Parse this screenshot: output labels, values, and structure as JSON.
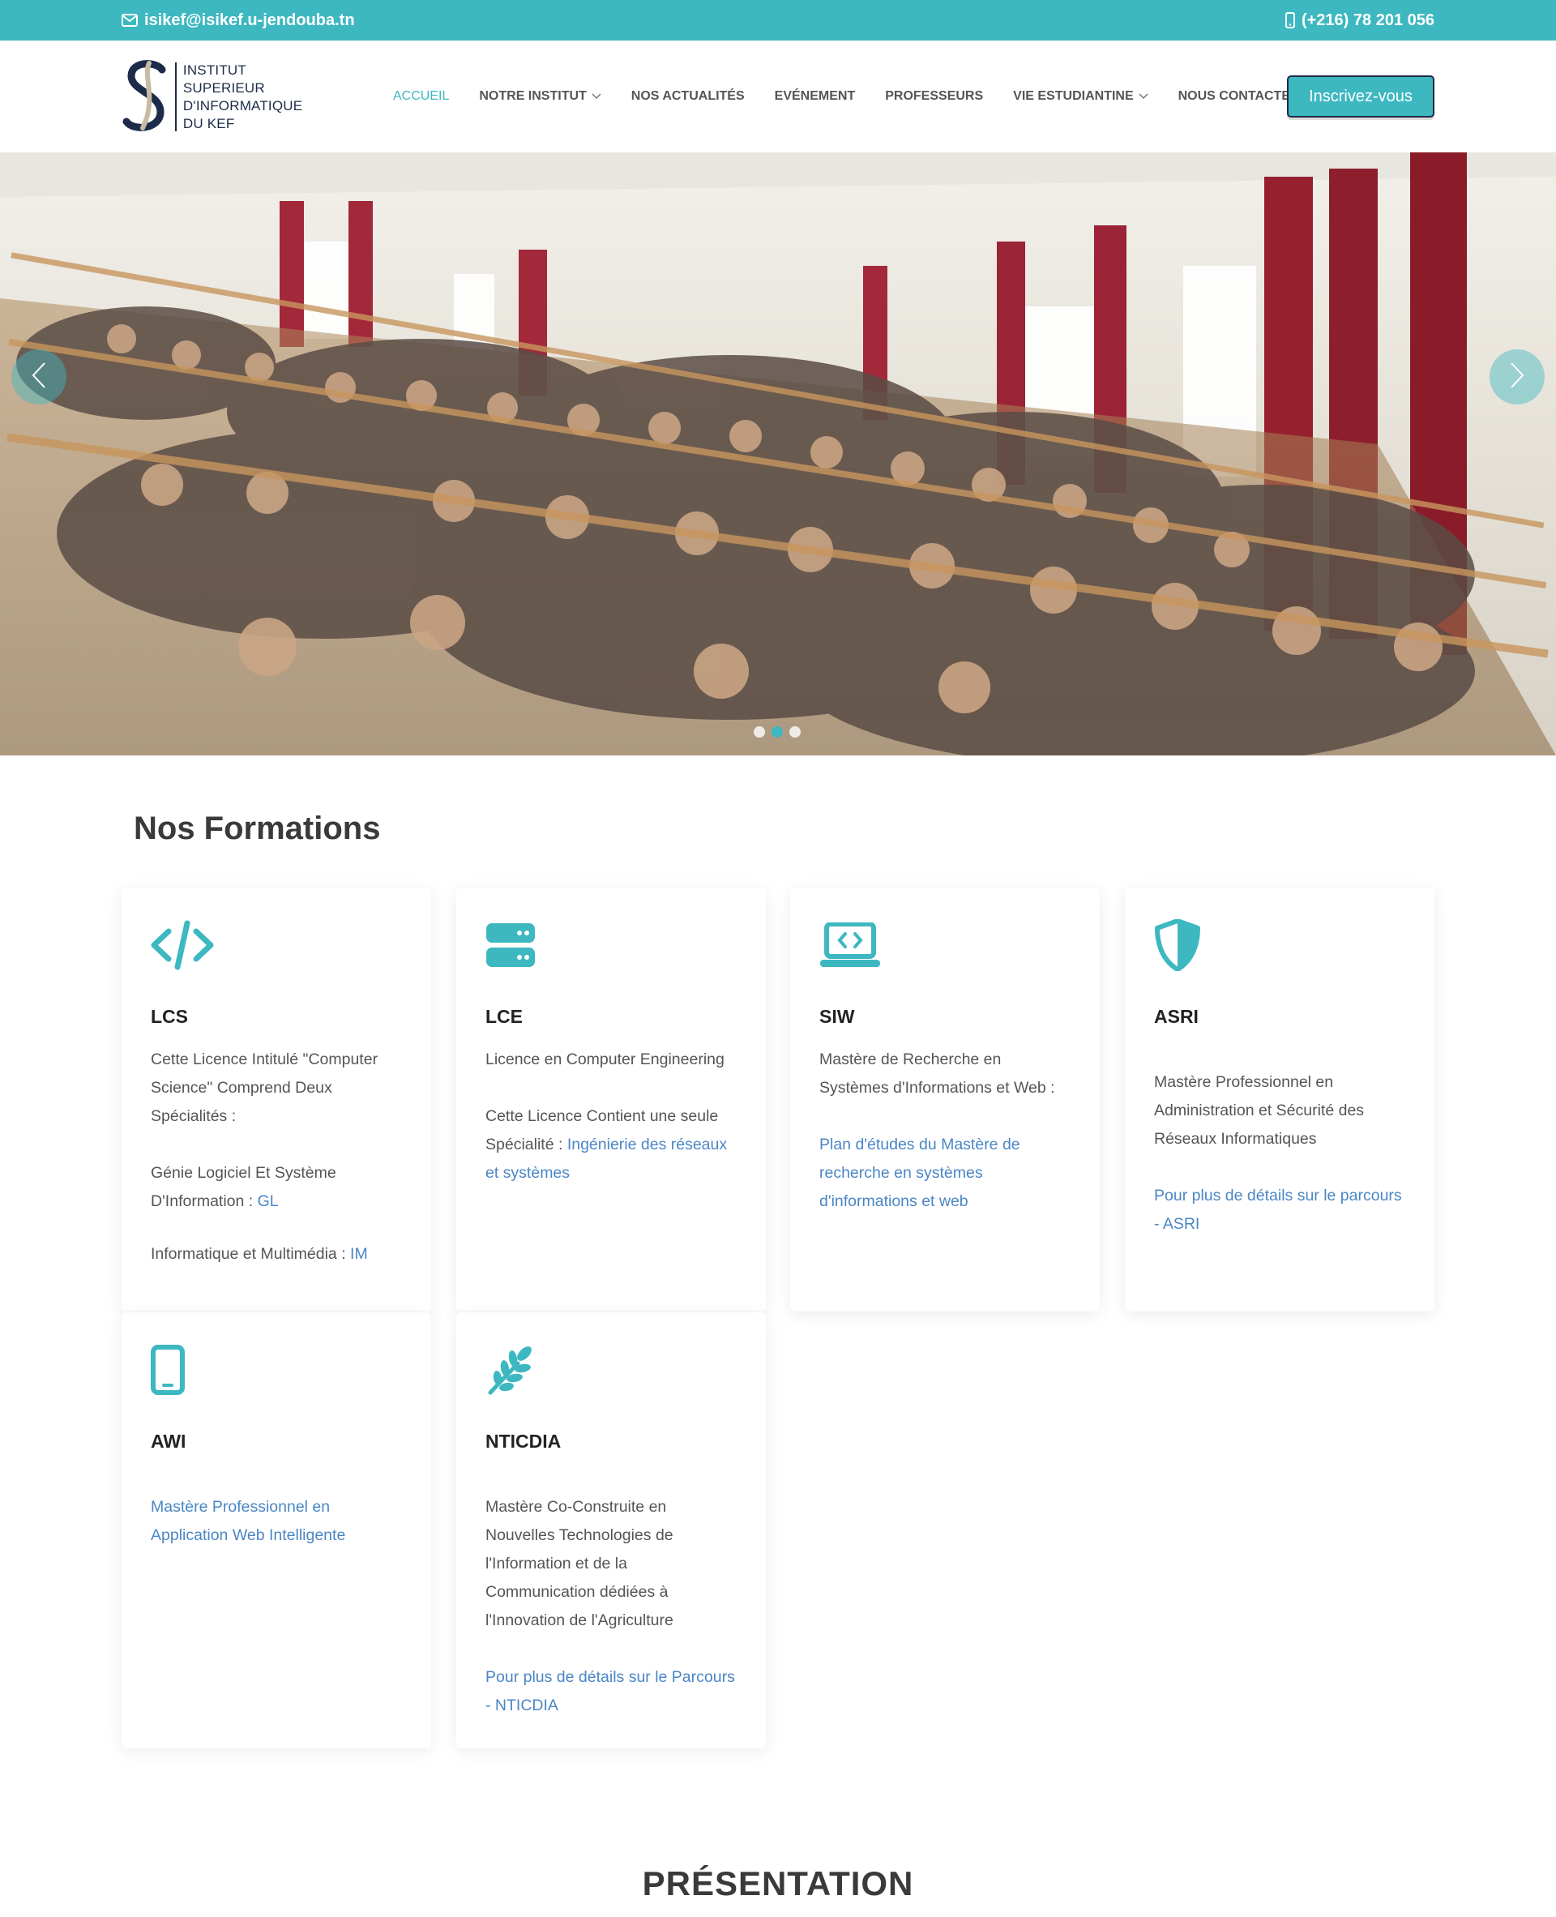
{
  "topbar": {
    "email": "isikef@isikef.u-jendouba.tn",
    "phone": "(+216) 78 201 056"
  },
  "logo": {
    "line1": "INSTITUT SUPERIEUR",
    "line2": "D'INFORMATIQUE",
    "line3": "DU KEF"
  },
  "nav": {
    "items": [
      {
        "label": "ACCUEIL",
        "active": true,
        "dropdown": false
      },
      {
        "label": "NOTRE INSTITUT",
        "active": false,
        "dropdown": true
      },
      {
        "label": "NOS ACTUALITÉS",
        "active": false,
        "dropdown": false
      },
      {
        "label": "EVÉNEMENT",
        "active": false,
        "dropdown": false
      },
      {
        "label": "PROFESSEURS",
        "active": false,
        "dropdown": false
      },
      {
        "label": "VIE ESTUDIANTINE",
        "active": false,
        "dropdown": true
      },
      {
        "label": "NOUS CONTACTER",
        "active": false,
        "dropdown": false
      }
    ],
    "cta": "Inscrivez-vous"
  },
  "hero": {
    "slide_count": 3,
    "active_slide": 2
  },
  "formations": {
    "title": "Nos Formations",
    "cards": [
      {
        "icon": "code-icon",
        "code": "LCS",
        "p1": "Cette Licence Intitulé \"Computer Science\" Comprend Deux Spécialités :",
        "p2_text": "Génie Logiciel Et Système D'Information : ",
        "p2_link": "GL",
        "p3_text": "Informatique et Multimédia : ",
        "p3_link": "IM"
      },
      {
        "icon": "server-icon",
        "code": "LCE",
        "p1": "Licence en Computer Engineering",
        "p2_text": "Cette Licence Contient une seule Spécialité : ",
        "p2_link": "Ingénierie des réseaux et systèmes"
      },
      {
        "icon": "laptop-code-icon",
        "code": "SIW",
        "p1": "Mastère de Recherche en Systèmes d'Informations et Web :",
        "p2_link": "Plan d'études du Mastère de recherche en systèmes d'informations et web"
      },
      {
        "icon": "shield-icon",
        "code": "ASRI",
        "p1": "Mastère Professionnel en Administration et Sécurité des Réseaux Informatiques",
        "p2_link": "Pour plus de détails sur le parcours - ASRI"
      },
      {
        "icon": "mobile-icon",
        "code": "AWI",
        "p1_link": "Mastère Professionnel en Application Web Intelligente"
      },
      {
        "icon": "wheat-icon",
        "code": "NTICDIA",
        "p1": "Mastère Co-Construite en Nouvelles Technologies de l'Information et de la Communication dédiées à l'Innovation de l'Agriculture",
        "p2_link": "Pour plus de détails sur le Parcours - NTICDIA"
      }
    ]
  },
  "presentation": {
    "title": "PRÉSENTATION"
  },
  "colors": {
    "accent": "#3db8c1",
    "navy": "#1d2b4a",
    "link": "#4a86c5"
  }
}
